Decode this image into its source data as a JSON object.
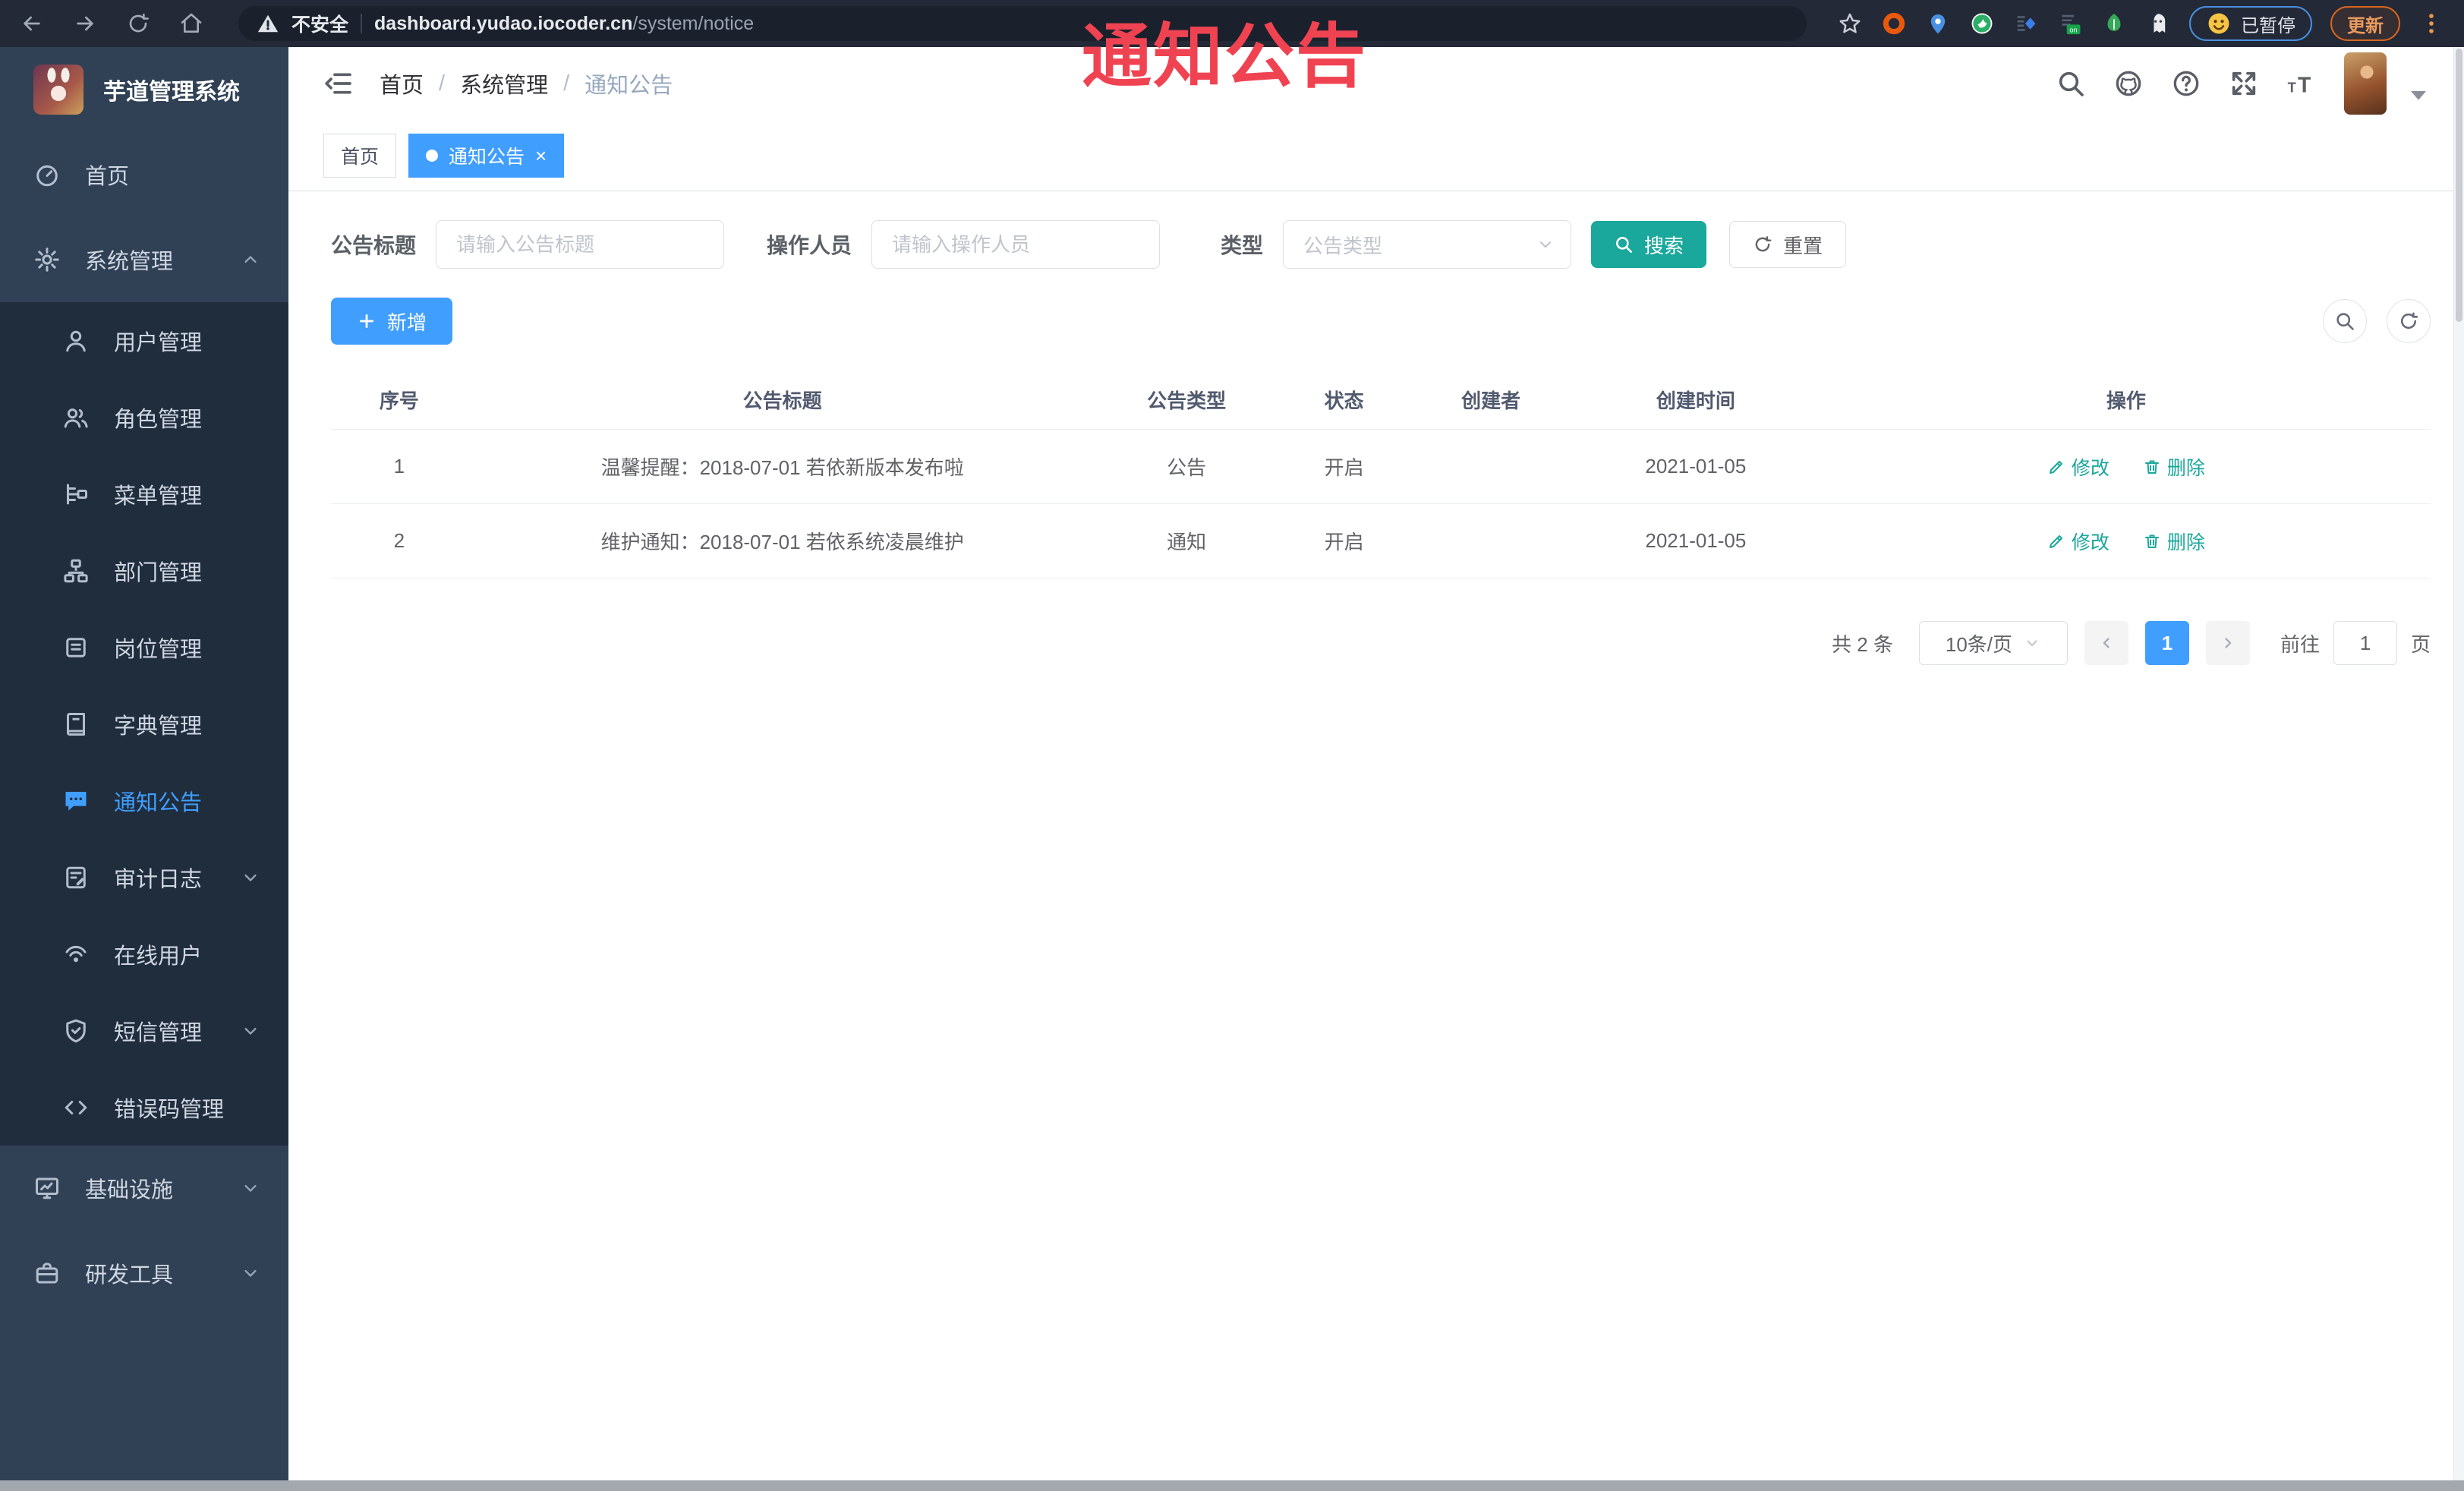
{
  "colors": {
    "primary": "#409eff",
    "search_button_teal": "#1aa79c",
    "annotation_red": "#f04352",
    "sidebar_bg": "#304156",
    "submenu_bg": "#1f2d3d",
    "chrome_bg": "#232936"
  },
  "browser": {
    "nav_icons": [
      "back-icon",
      "forward-icon",
      "reload-icon",
      "home-icon"
    ],
    "security_label": "不安全",
    "url_host": "dashboard.yudao.iocoder.cn",
    "url_path": "/system/notice",
    "extension_icons": [
      "bookmark-star",
      "orange-ring",
      "blue-pin",
      "green-circle",
      "blue-diamond",
      "on-badge",
      "green-leaf",
      "white-ghost"
    ],
    "paused_label": "已暂停",
    "update_label": "更新"
  },
  "annotation": {
    "text": "通知公告"
  },
  "sidebar": {
    "title": "芋道管理系统",
    "home": {
      "label": "首页",
      "icon": "dashboard-icon"
    },
    "system": {
      "label": "系统管理",
      "icon": "gear-icon"
    },
    "children": [
      {
        "label": "用户管理",
        "icon": "user-icon"
      },
      {
        "label": "角色管理",
        "icon": "peoples-icon"
      },
      {
        "label": "菜单管理",
        "icon": "tree-table-icon"
      },
      {
        "label": "部门管理",
        "icon": "tree-icon"
      },
      {
        "label": "岗位管理",
        "icon": "post-icon"
      },
      {
        "label": "字典管理",
        "icon": "dict-icon"
      },
      {
        "label": "通知公告",
        "icon": "message-icon",
        "active": true
      },
      {
        "label": "审计日志",
        "icon": "log-icon",
        "expandable": true
      },
      {
        "label": "在线用户",
        "icon": "online-icon"
      },
      {
        "label": "短信管理",
        "icon": "sms-shield-icon",
        "expandable": true
      },
      {
        "label": "错误码管理",
        "icon": "code-icon"
      }
    ],
    "infra": {
      "label": "基础设施",
      "icon": "infra-icon"
    },
    "devtools": {
      "label": "研发工具",
      "icon": "tool-icon"
    }
  },
  "breadcrumb": {
    "items": [
      "首页",
      "系统管理",
      "通知公告"
    ]
  },
  "navbar_icons": [
    "search-icon",
    "github-icon",
    "help-icon",
    "fullscreen-icon",
    "font-size-icon",
    "avatar",
    "caret-down-icon"
  ],
  "tabs": [
    {
      "label": "首页",
      "active": false
    },
    {
      "label": "通知公告",
      "active": true,
      "close": "×"
    }
  ],
  "filters": {
    "title_label": "公告标题",
    "title_placeholder": "请输入公告标题",
    "operator_label": "操作人员",
    "operator_placeholder": "请输入操作人员",
    "type_label": "类型",
    "type_placeholder": "公告类型",
    "search_label": "搜索",
    "reset_label": "重置"
  },
  "toolbar": {
    "add_label": "新增"
  },
  "table": {
    "columns": [
      "序号",
      "公告标题",
      "公告类型",
      "状态",
      "创建者",
      "创建时间",
      "操作"
    ],
    "rows": [
      {
        "index": "1",
        "title": "温馨提醒：2018-07-01 若依新版本发布啦",
        "type": "公告",
        "status": "开启",
        "creator": "",
        "created_at": "2021-01-05"
      },
      {
        "index": "2",
        "title": "维护通知：2018-07-01 若依系统凌晨维护",
        "type": "通知",
        "status": "开启",
        "creator": "",
        "created_at": "2021-01-05"
      }
    ],
    "edit_label": "修改",
    "delete_label": "删除"
  },
  "pagination": {
    "total": "共 2 条",
    "page_size": "10条/页",
    "page": "1",
    "goto_label": "前往",
    "goto_value": "1",
    "page_unit": "页"
  }
}
